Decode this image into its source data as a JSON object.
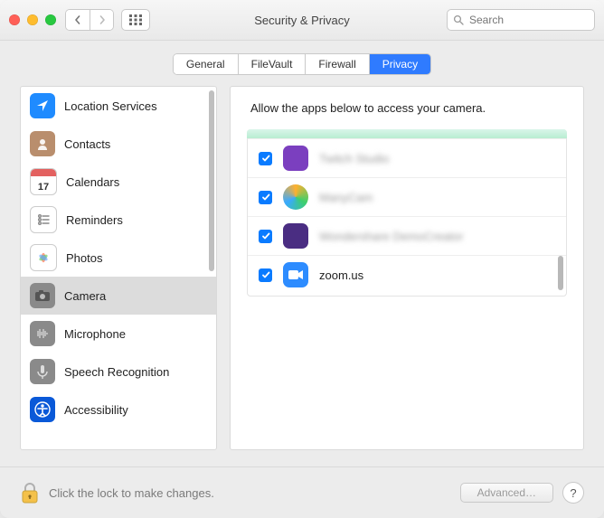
{
  "window": {
    "title": "Security & Privacy"
  },
  "search": {
    "placeholder": "Search",
    "value": ""
  },
  "tabs": [
    {
      "label": "General",
      "active": false
    },
    {
      "label": "FileVault",
      "active": false
    },
    {
      "label": "Firewall",
      "active": false
    },
    {
      "label": "Privacy",
      "active": true
    }
  ],
  "sidebar": {
    "items": [
      {
        "label": "Location Services",
        "icon": "location",
        "selected": false
      },
      {
        "label": "Contacts",
        "icon": "contacts",
        "selected": false
      },
      {
        "label": "Calendars",
        "icon": "calendar",
        "selected": false
      },
      {
        "label": "Reminders",
        "icon": "reminders",
        "selected": false
      },
      {
        "label": "Photos",
        "icon": "photos",
        "selected": false
      },
      {
        "label": "Camera",
        "icon": "camera",
        "selected": true
      },
      {
        "label": "Microphone",
        "icon": "mic",
        "selected": false
      },
      {
        "label": "Speech Recognition",
        "icon": "speech",
        "selected": false
      },
      {
        "label": "Accessibility",
        "icon": "accessibility",
        "selected": false
      }
    ]
  },
  "main": {
    "heading": "Allow the apps below to access your camera.",
    "apps": [
      {
        "label": "Twitch Studio",
        "checked": true,
        "blurred": true,
        "icon_color": "#7b3fbf"
      },
      {
        "label": "ManyCam",
        "checked": true,
        "blurred": true,
        "icon_color": "#33b564"
      },
      {
        "label": "Wondershare DemoCreator",
        "checked": true,
        "blurred": true,
        "icon_color": "#4a2d82"
      },
      {
        "label": "zoom.us",
        "checked": true,
        "blurred": false,
        "icon_color": "#2d8cff"
      }
    ]
  },
  "footer": {
    "lock_text": "Click the lock to make changes.",
    "advanced_label": "Advanced…",
    "help_label": "?"
  }
}
